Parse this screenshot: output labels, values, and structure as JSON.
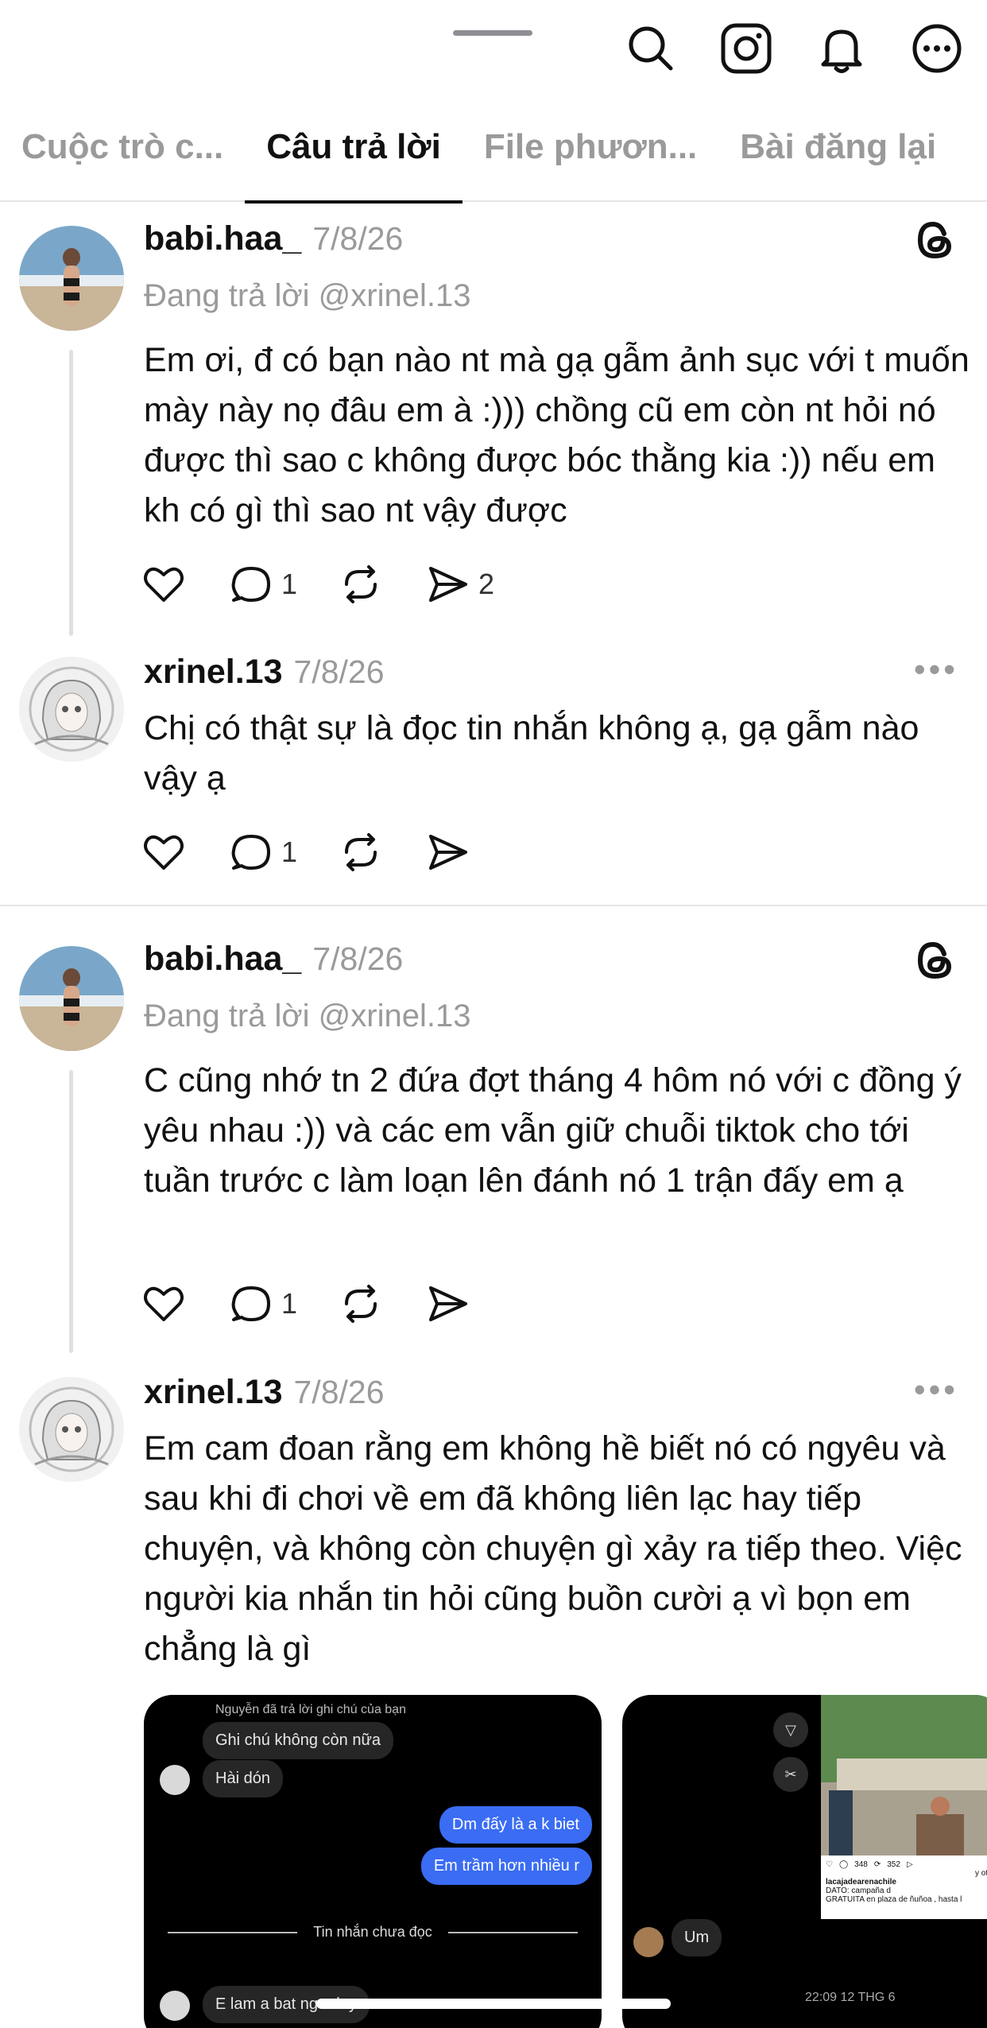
{
  "tabs": [
    "Cuộc trò c...",
    "Câu trả lời",
    "File phươn...",
    "Bài đăng lại"
  ],
  "posts": [
    {
      "username": "babi.haa_",
      "date": "7/8/26",
      "replying": "Đang trả lời @xrinel.13",
      "text": "Em ơi, đ có bạn nào nt mà gạ gẫm ảnh sục với t muốn mày này nọ đâu em à :))) chồng cũ em còn nt hỏi nó được thì sao c không được bóc thằng kia :)) nếu em kh có gì thì sao nt vậy được",
      "comments": "1",
      "shares": "2"
    },
    {
      "username": "xrinel.13",
      "date": "7/8/26",
      "text": "Chị có thật sự là đọc tin nhắn không ạ, gạ gẫm nào vậy ạ",
      "comments": "1"
    },
    {
      "username": "babi.haa_",
      "date": "7/8/26",
      "replying": "Đang trả lời @xrinel.13",
      "text": "C cũng nhớ tn 2 đứa đợt tháng 4 hôm nó với c đồng ý yêu nhau :)) và các em vẫn giữ chuỗi tiktok cho tới tuần trước c làm loạn lên đánh nó 1 trận đấy em ạ",
      "comments": "1"
    },
    {
      "username": "xrinel.13",
      "date": "7/8/26",
      "text": "Em cam đoan rằng em không hề biết nó có ngyêu và sau khi đi chơi về em đã không liên lạc hay tiếp chuyện, và không còn chuyện gì xảy ra tiếp theo. Việc người kia nhắn tin hỏi cũng buồn cười ạ vì bọn em chẳng là gì"
    }
  ],
  "attachment1": {
    "caption": "Nguyễn đã trả lời ghi chú của bạn",
    "note": "Ghi chú không còn nữa",
    "msg1": "Hài dón",
    "msg2": "Dm đấy là a k biet",
    "msg3": "Em trầm hơn nhiều r",
    "unread": "Tin nhắn chưa đọc",
    "msg4": "E lam a bat ngo day"
  },
  "attachment2": {
    "likes": "348",
    "reposts": "352",
    "shared_by": "y otros",
    "account": "lacajadearenachile",
    "caption_line1": "DATO: campaña d",
    "caption_line2": "GRATUITA en plaza de ñuñoa , hasta l",
    "msg": "Um",
    "time": "22:09 12 THG 6"
  },
  "colors": {
    "accent_blue": "#3a6cf4",
    "muted": "#9a9a9a"
  }
}
